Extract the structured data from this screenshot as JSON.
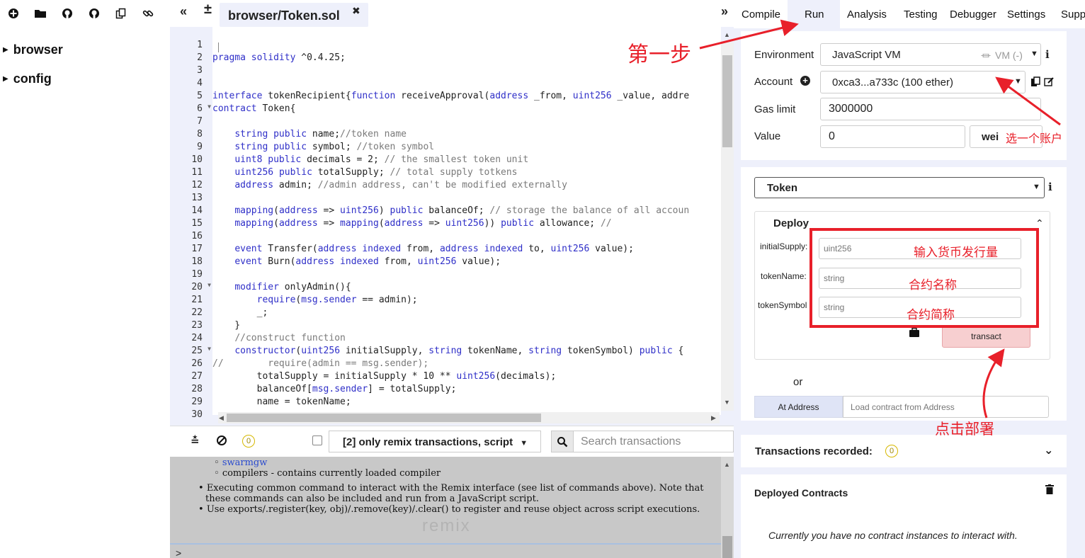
{
  "sidebar": {
    "tree": [
      {
        "label": "browser"
      },
      {
        "label": "config"
      }
    ]
  },
  "editor": {
    "file_tab": "browser/Token.sol",
    "line_numbers": [
      "1",
      "2",
      "3",
      "4",
      "5",
      "6",
      "7",
      "8",
      "9",
      "10",
      "11",
      "12",
      "13",
      "14",
      "15",
      "16",
      "17",
      "18",
      "19",
      "20",
      "21",
      "22",
      "23",
      "24",
      "25",
      "26",
      "27",
      "28",
      "29",
      "30"
    ],
    "code": [
      "",
      "pragma solidity ^0.4.25;",
      "",
      "",
      "interface tokenRecipient{function receiveApproval(address _from, uint256 _value, addre",
      "contract Token{",
      "",
      "    string public name;//token name",
      "    string public symbol; //token symbol",
      "    uint8 public decimals = 2; // the smallest token unit",
      "    uint256 public totalSupply; // total supply totkens",
      "    address admin; //admin address, can't be modified externally",
      "",
      "    mapping(address => uint256) public balanceOf; // storage the balance of all accoun",
      "    mapping(address => mapping(address => uint256)) public allowance; //",
      "",
      "    event Transfer(address indexed from, address indexed to, uint256 value);",
      "    event Burn(address indexed from, uint256 value);",
      "",
      "    modifier onlyAdmin(){",
      "        require(msg.sender == admin);",
      "        _;",
      "    }",
      "    //construct function",
      "    constructor(uint256 initialSupply, string tokenName, string tokenSymbol) public {",
      "//        require(admin == msg.sender);",
      "        totalSupply = initialSupply * 10 ** uint256(decimals);",
      "        balanceOf[msg.sender] = totalSupply;",
      "        name = tokenName;",
      ""
    ]
  },
  "terminal": {
    "badge": "0",
    "filter": "[2] only remix transactions, script",
    "search_placeholder": "Search transactions",
    "line_link": "swarmgw",
    "line_compilers": "compilers - contains currently loaded compiler",
    "line_exec": "Executing common command to interact with the Remix interface (see list of commands above). Note that these commands can also be included and run from a JavaScript script.",
    "line_exports": "Use exports/.register(key, obj)/.remove(key)/.clear() to register and reuse object across script executions.",
    "watermark": "remix",
    "prompt": ">"
  },
  "right_tabs": [
    "Compile",
    "Run",
    "Analysis",
    "Testing",
    "Debugger",
    "Settings",
    "Supp"
  ],
  "run": {
    "environment_label": "Environment",
    "environment_value": "JavaScript VM",
    "vm_badge": "VM (-)",
    "account_label": "Account",
    "account_value": "0xca3...a733c (100 ether)",
    "gas_label": "Gas limit",
    "gas_value": "3000000",
    "value_label": "Value",
    "value_value": "0",
    "value_unit": "wei",
    "contract_select": "Token",
    "deploy_title": "Deploy",
    "params": [
      {
        "label": "initialSupply:",
        "placeholder": "uint256"
      },
      {
        "label": "tokenName:",
        "placeholder": "string"
      },
      {
        "label": "tokenSymbol",
        "placeholder": "string"
      }
    ],
    "transact": "transact",
    "or": "or",
    "at_address": "At Address",
    "load_placeholder": "Load contract from Address",
    "tx_recorded": "Transactions recorded:",
    "tx_count": "0",
    "deployed_title": "Deployed Contracts",
    "no_instances": "Currently you have no contract instances to interact with."
  },
  "annotations": {
    "step1": "第一步",
    "choose_account": "选一个账户",
    "supply": "输入货币发行量",
    "contract_name": "合约名称",
    "contract_symbol": "合约简称",
    "click_deploy": "点击部署"
  },
  "colors": {
    "panel_bg": "#eef0fb",
    "annotation_red": "#e8202a",
    "transact_bg": "#f7cfd0",
    "at_address_bg": "#dfe4f6",
    "terminal_bg": "#c8c8c8",
    "kw_blue": "#2f2fc8",
    "comment_gray": "#7a7a7a"
  }
}
